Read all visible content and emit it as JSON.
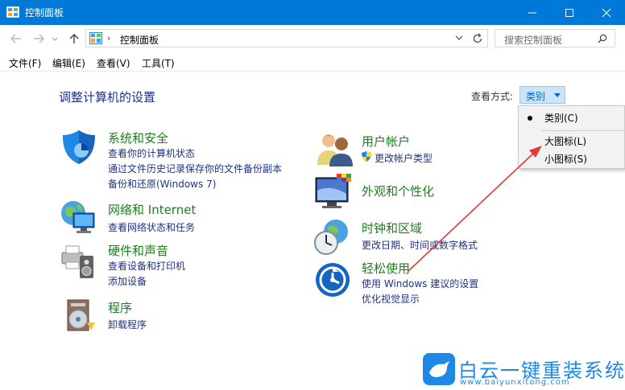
{
  "window": {
    "title": "控制面板"
  },
  "address": {
    "path": "控制面板",
    "separator": "›",
    "search_placeholder": "搜索控制面板"
  },
  "menu": [
    "文件(F)",
    "编辑(E)",
    "查看(V)",
    "工具(T)"
  ],
  "main": {
    "heading": "调整计算机的设置",
    "view_by_label": "查看方式:",
    "view_by_value": "类别",
    "view_options": [
      "类别(C)",
      "大图标(L)",
      "小图标(S)"
    ],
    "selected_option": "类别(C)"
  },
  "categories": {
    "security": {
      "title": "系统和安全",
      "links": [
        "查看你的计算机状态",
        "通过文件历史记录保存你的文件备份副本",
        "备份和还原(Windows 7)"
      ]
    },
    "network": {
      "title": "网络和 Internet",
      "links": [
        "查看网络状态和任务"
      ]
    },
    "hardware": {
      "title": "硬件和声音",
      "links": [
        "查看设备和打印机",
        "添加设备"
      ]
    },
    "programs": {
      "title": "程序",
      "links": [
        "卸载程序"
      ]
    },
    "users": {
      "title": "用户帐户",
      "links": [
        "更改帐户类型"
      ]
    },
    "appearance": {
      "title": "外观和个性化",
      "links": []
    },
    "clock": {
      "title": "时钟和区域",
      "links": [
        "更改日期、时间或数字格式"
      ]
    },
    "ease": {
      "title": "轻松使用",
      "links": [
        "使用 Windows 建议的设置",
        "优化视觉显示"
      ]
    }
  },
  "watermark": {
    "title": "白云一键重装系统",
    "url": "www.baiyunxitong.com"
  },
  "colors": {
    "accent": "#0078d7",
    "link": "#1e3287",
    "category": "#1e7e1e",
    "arrow": "#e53935"
  }
}
